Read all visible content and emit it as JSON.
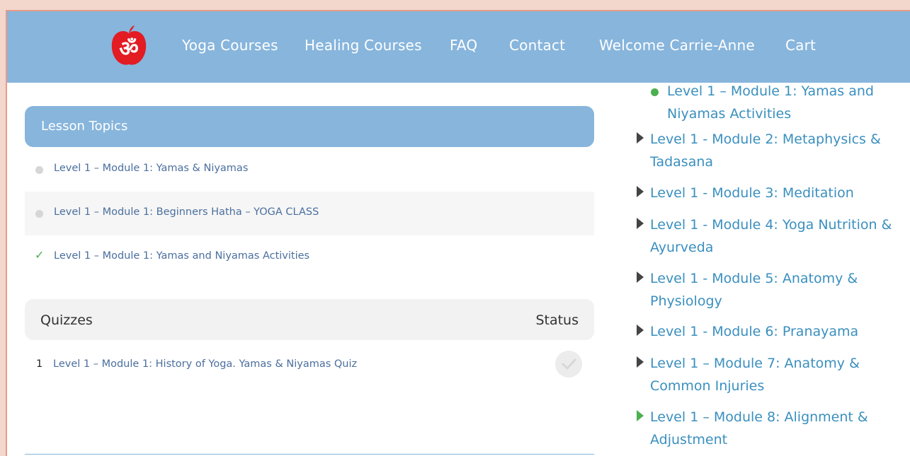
{
  "nav": {
    "items": [
      "Yoga Courses",
      "Healing Courses",
      "FAQ",
      "Contact",
      "Welcome Carrie-Anne",
      "Cart"
    ],
    "logo_text": "ॐ"
  },
  "lesson_topics": {
    "title": "Lesson Topics",
    "items": [
      {
        "label": "Level 1 – Module 1: Yamas & Niyamas",
        "status": "incomplete"
      },
      {
        "label": "Level 1 – Module 1: Beginners Hatha – YOGA CLASS",
        "status": "incomplete"
      },
      {
        "label": "Level 1 – Module 1: Yamas and Niyamas Activities",
        "status": "complete"
      }
    ]
  },
  "quizzes": {
    "title": "Quizzes",
    "status_label": "Status",
    "items": [
      {
        "number": "1",
        "label": "Level 1 – Module 1: History of Yoga. Yamas & Niyamas Quiz"
      }
    ]
  },
  "sidebar": {
    "current_sub": "Level 1 – Module 1: Yamas and Niyamas Activities",
    "modules": [
      "Level 1 - Module 2: Metaphysics & Tadasana",
      "Level 1 - Module 3: Meditation",
      "Level 1 - Module 4: Yoga Nutrition & Ayurveda",
      "Level 1 - Module 5: Anatomy & Physiology",
      "Level 1 - Module 6: Pranayama",
      "Level 1 – Module 7: Anatomy & Common Injuries",
      "Level 1 – Module 8: Alignment & Adjustment"
    ]
  },
  "colors": {
    "header": "#87b5dc",
    "link": "#3a8fbf",
    "complete": "#4caf50",
    "logo": "#e31b23"
  }
}
